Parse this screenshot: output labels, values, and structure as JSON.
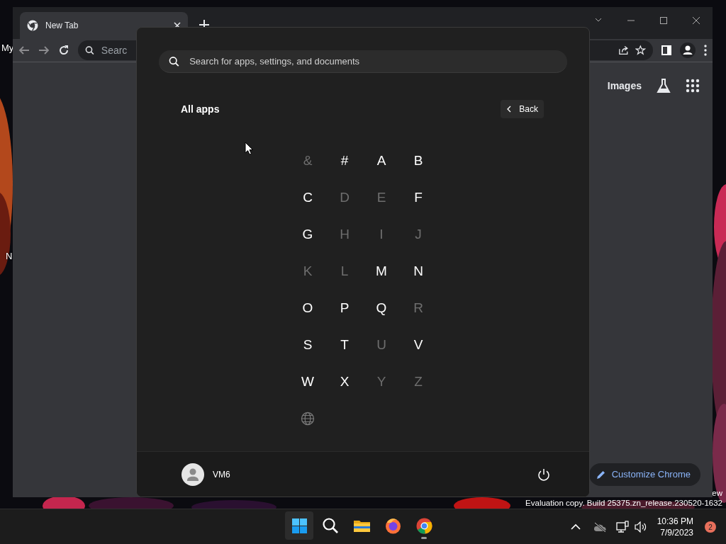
{
  "desktop": {
    "icon_labels": [
      "My",
      "N"
    ],
    "watermark_lines": [
      "ew",
      "Evaluation copy. Build 25375.zn_release.230520-1632"
    ]
  },
  "browser": {
    "tab": {
      "title": "New Tab"
    },
    "address_bar": {
      "placeholder": "Searc"
    },
    "header_link": "Images",
    "customize_button": "Customize Chrome"
  },
  "start_menu": {
    "search": {
      "placeholder": "Search for apps, settings, and documents"
    },
    "heading": "All apps",
    "back_button": "Back",
    "letters": [
      {
        "kind": "letter",
        "label": "&",
        "enabled": false
      },
      {
        "kind": "letter",
        "label": "#",
        "enabled": true
      },
      {
        "kind": "letter",
        "label": "A",
        "enabled": true
      },
      {
        "kind": "letter",
        "label": "B",
        "enabled": true
      },
      {
        "kind": "letter",
        "label": "C",
        "enabled": true
      },
      {
        "kind": "letter",
        "label": "D",
        "enabled": false
      },
      {
        "kind": "letter",
        "label": "E",
        "enabled": false
      },
      {
        "kind": "letter",
        "label": "F",
        "enabled": true
      },
      {
        "kind": "letter",
        "label": "G",
        "enabled": true
      },
      {
        "kind": "letter",
        "label": "H",
        "enabled": false
      },
      {
        "kind": "letter",
        "label": "I",
        "enabled": false
      },
      {
        "kind": "letter",
        "label": "J",
        "enabled": false
      },
      {
        "kind": "letter",
        "label": "K",
        "enabled": false
      },
      {
        "kind": "letter",
        "label": "L",
        "enabled": false
      },
      {
        "kind": "letter",
        "label": "M",
        "enabled": true
      },
      {
        "kind": "letter",
        "label": "N",
        "enabled": true
      },
      {
        "kind": "letter",
        "label": "O",
        "enabled": true
      },
      {
        "kind": "letter",
        "label": "P",
        "enabled": true
      },
      {
        "kind": "letter",
        "label": "Q",
        "enabled": true
      },
      {
        "kind": "letter",
        "label": "R",
        "enabled": false
      },
      {
        "kind": "letter",
        "label": "S",
        "enabled": true
      },
      {
        "kind": "letter",
        "label": "T",
        "enabled": true
      },
      {
        "kind": "letter",
        "label": "U",
        "enabled": false
      },
      {
        "kind": "letter",
        "label": "V",
        "enabled": true
      },
      {
        "kind": "letter",
        "label": "W",
        "enabled": true
      },
      {
        "kind": "letter",
        "label": "X",
        "enabled": true
      },
      {
        "kind": "letter",
        "label": "Y",
        "enabled": false
      },
      {
        "kind": "letter",
        "label": "Z",
        "enabled": false
      },
      {
        "kind": "globe",
        "enabled": false
      }
    ],
    "user": {
      "name": "VM6"
    }
  },
  "taskbar": {
    "apps": [
      {
        "kind": "start",
        "selected": true,
        "running": false
      },
      {
        "kind": "search",
        "selected": false,
        "running": false
      },
      {
        "kind": "files",
        "selected": false,
        "running": false
      },
      {
        "kind": "firefox",
        "selected": false,
        "running": false
      },
      {
        "kind": "chrome",
        "selected": false,
        "running": true
      }
    ],
    "time": "10:36 PM",
    "date": "7/9/2023",
    "notification_count": "2"
  }
}
